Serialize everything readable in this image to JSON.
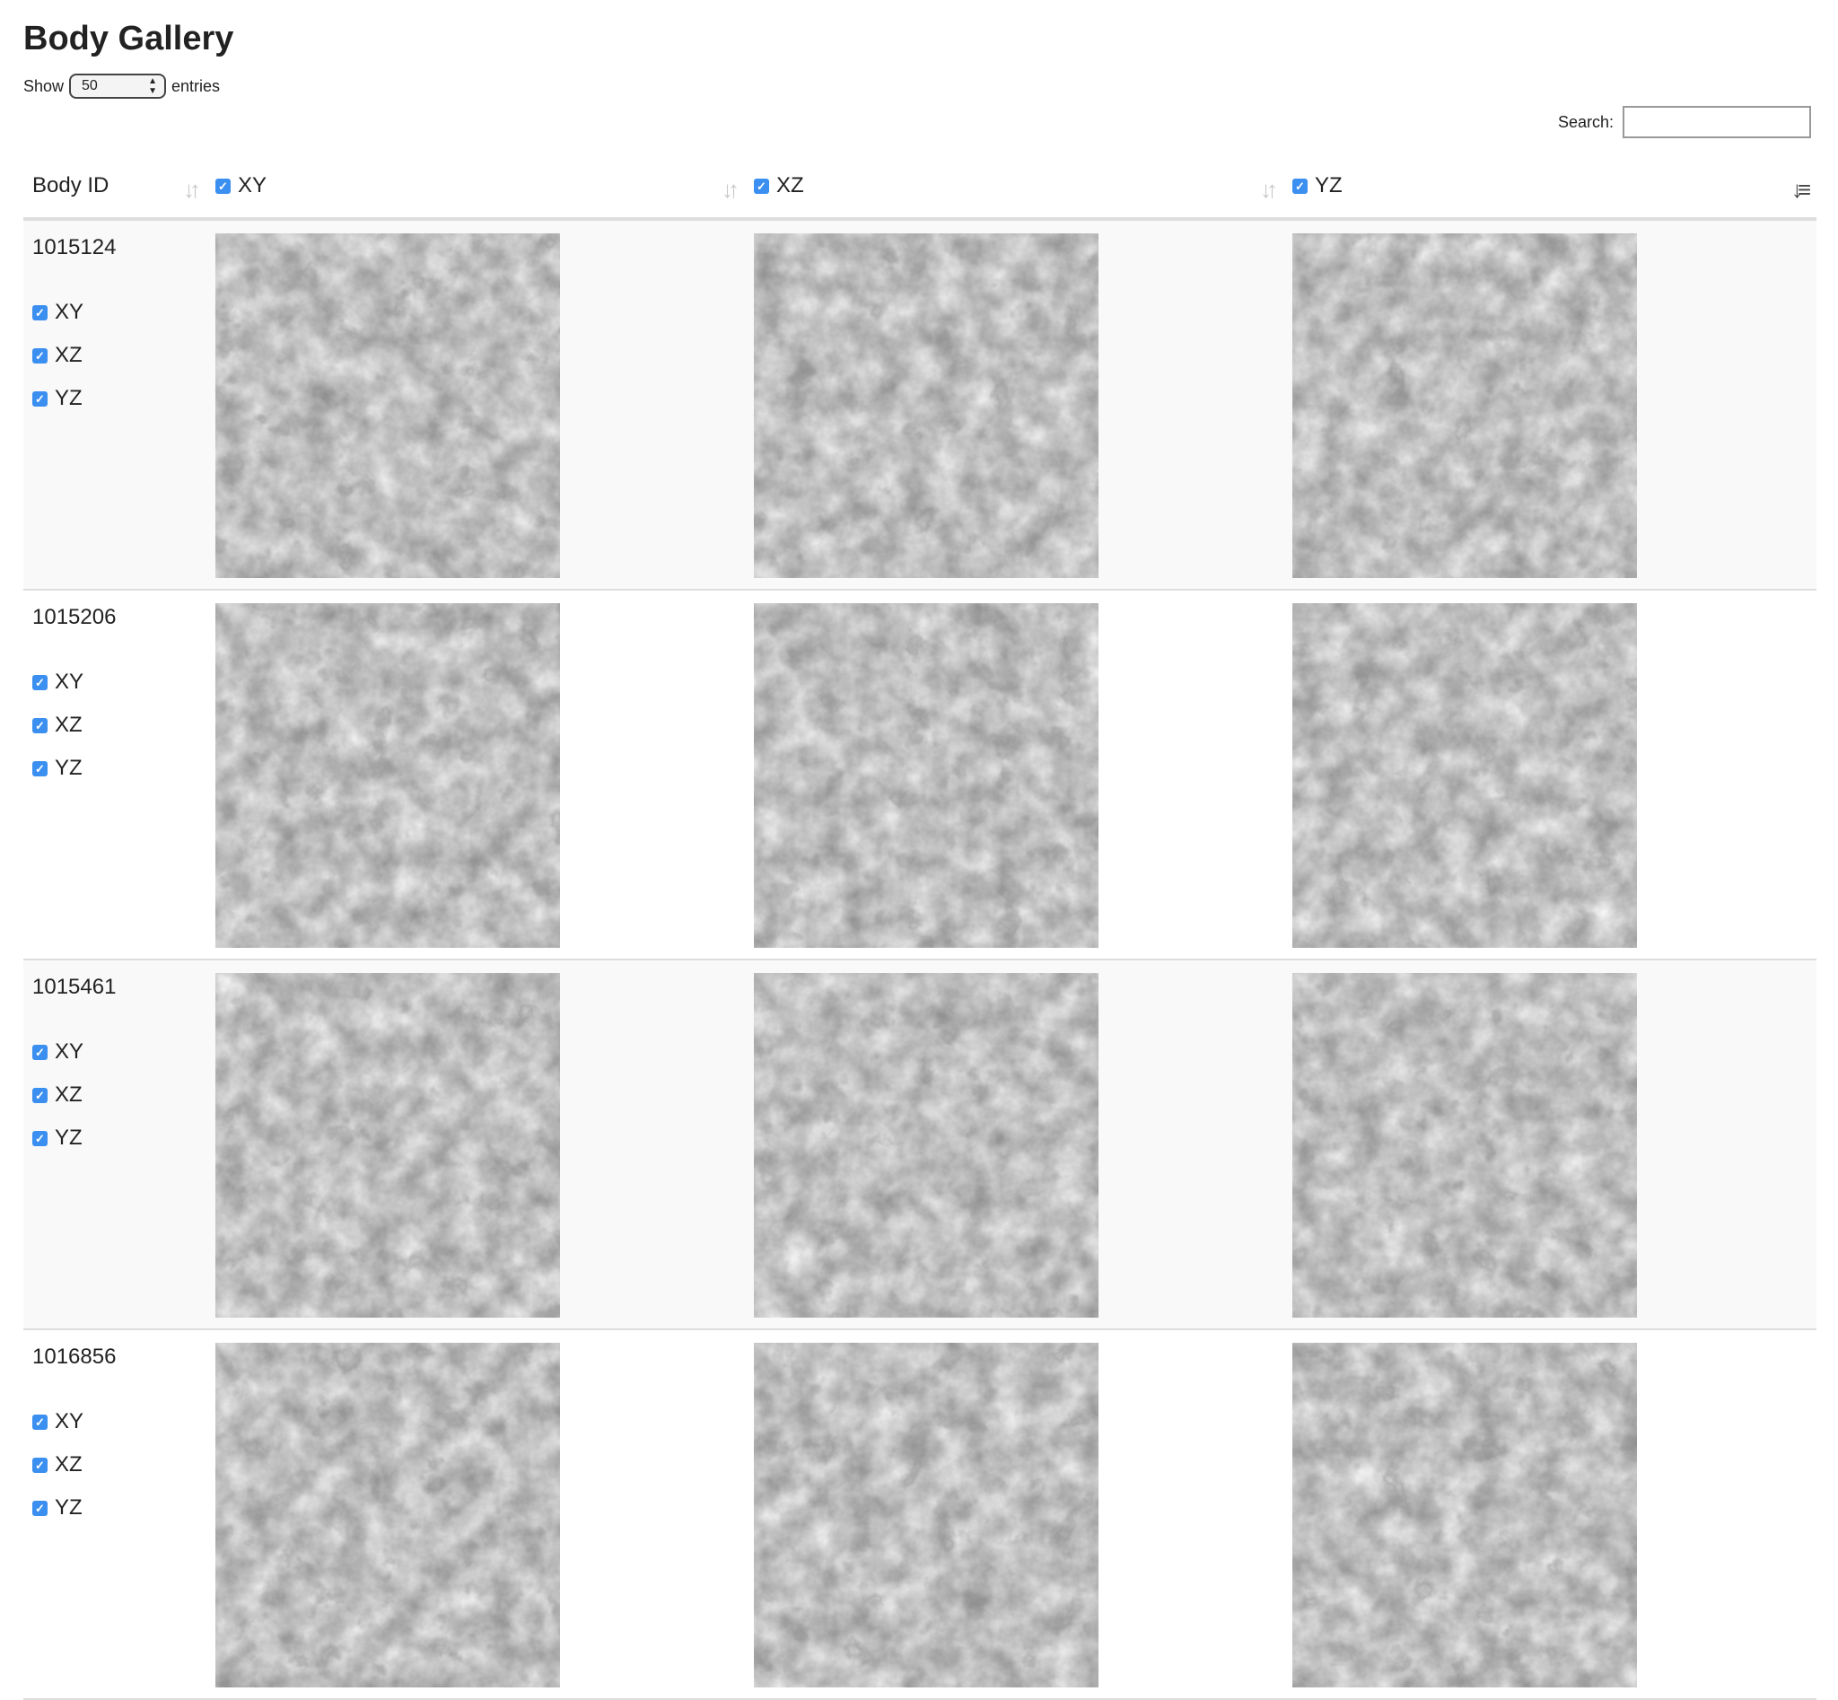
{
  "page": {
    "title": "Body Gallery"
  },
  "length": {
    "show_label": "Show",
    "value": "50",
    "entries_label": "entries"
  },
  "search": {
    "label": "Search:",
    "value": ""
  },
  "columns": [
    {
      "label": "Body ID",
      "sort": "unsorted"
    },
    {
      "label": "XY",
      "checked": true,
      "sort": "unsorted"
    },
    {
      "label": "XZ",
      "checked": true,
      "sort": "unsorted"
    },
    {
      "label": "YZ",
      "checked": true,
      "sort": "descending"
    }
  ],
  "rows": [
    {
      "body_id": "1015124",
      "views": [
        "XY",
        "XZ",
        "YZ"
      ]
    },
    {
      "body_id": "1015206",
      "views": [
        "XY",
        "XZ",
        "YZ"
      ]
    },
    {
      "body_id": "1015461",
      "views": [
        "XY",
        "XZ",
        "YZ"
      ]
    },
    {
      "body_id": "1016856",
      "views": [
        "XY",
        "XZ",
        "YZ"
      ]
    }
  ],
  "colors": {
    "checkbox": "#3b8ff0",
    "row_stripe": "#f9f9f9",
    "border": "#dddddd"
  },
  "icons": {
    "sort": "sort-both-icon",
    "sort_active": "sort-desc-icon",
    "checkbox": "checkbox-checked-icon"
  }
}
